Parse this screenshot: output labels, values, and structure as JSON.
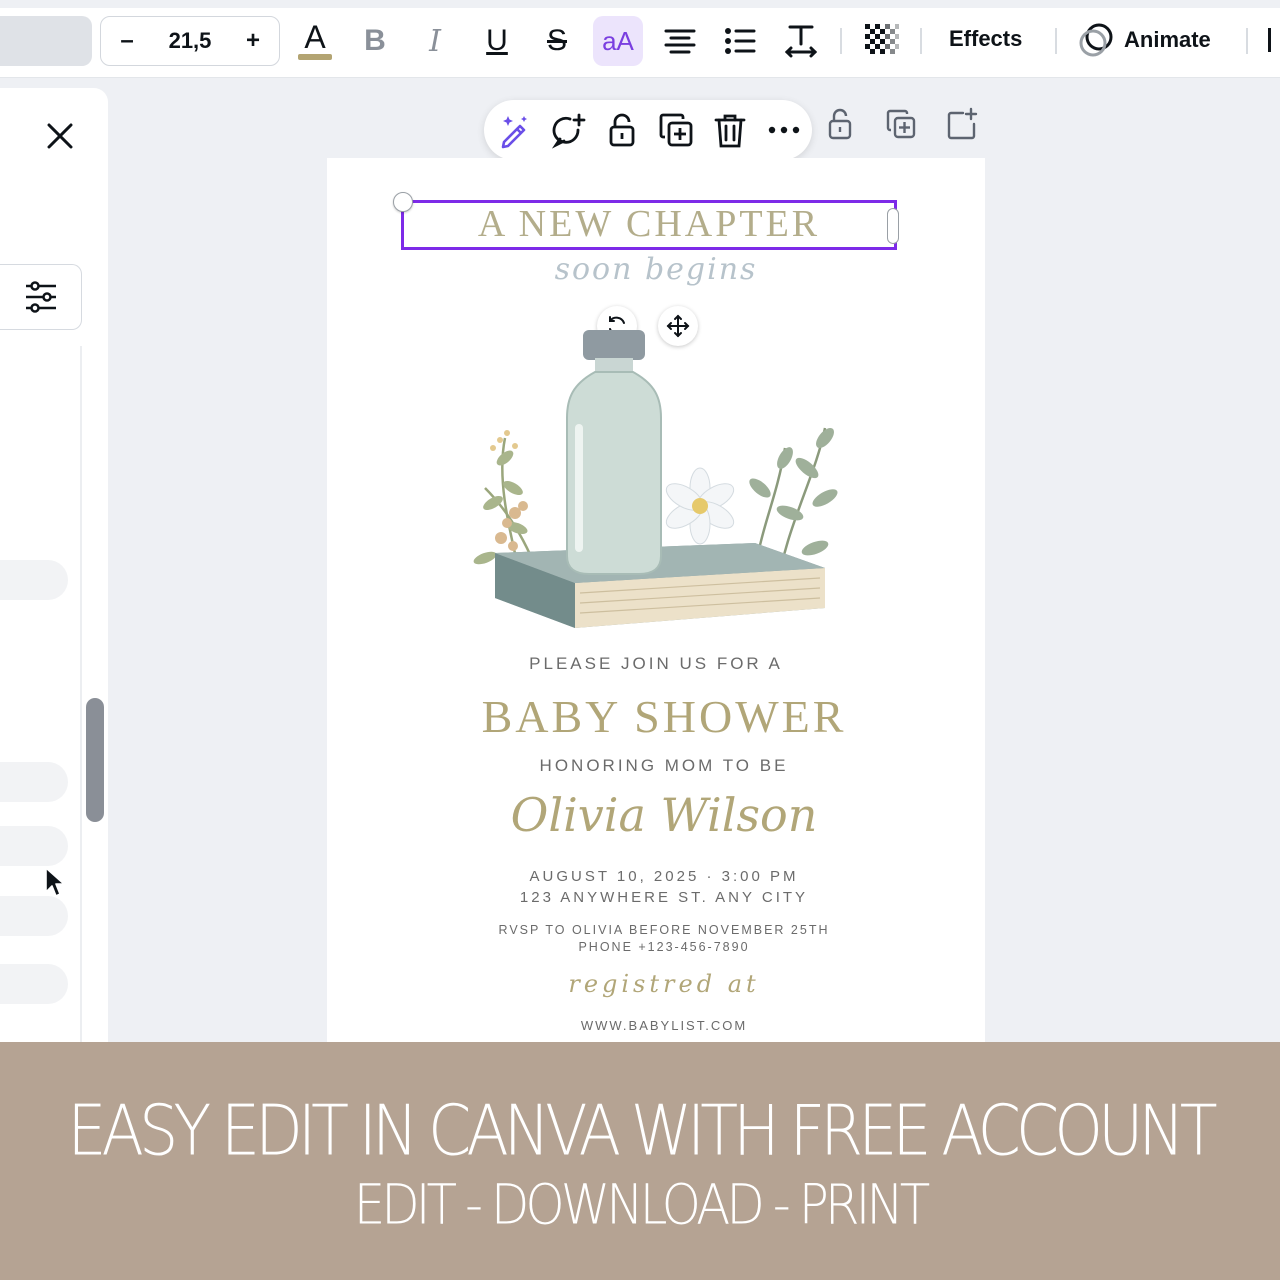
{
  "toolbar": {
    "font_size_decrease": "–",
    "font_size": "21,5",
    "font_size_increase": "+",
    "text_color_glyph": "A",
    "bold_glyph": "B",
    "italic_glyph": "I",
    "underline_glyph": "U",
    "strike_glyph": "S",
    "case_glyph": "aA",
    "effects_label": "Effects",
    "animate_label": "Animate",
    "text_color_swatch": "#b3a472",
    "accent": "#7d2ae8"
  },
  "document": {
    "heading": "A NEW CHAPTER",
    "script_line": "soon begins",
    "invite_line": "PLEASE JOIN US FOR A",
    "event_title": "BABY SHOWER",
    "honoring_line": "HONORING MOM TO BE",
    "guest_name": "Olivia Wilson",
    "date_line": "AUGUST 10, 2025 · 3:00 PM",
    "address_line": "123 ANYWHERE ST. ANY CITY",
    "rsvp_line": "RVSP TO OLIVIA BEFORE NOVEMBER 25TH",
    "phone_line": "PHONE +123-456-7890",
    "registry_label": "registred at",
    "registry_url": "WWW.BABYLIST.COM"
  },
  "banner": {
    "title": "EASY EDIT IN CANVA WITH FREE ACCOUNT",
    "subtitle": "EDIT - DOWNLOAD - PRINT",
    "background": "#b5a393"
  }
}
